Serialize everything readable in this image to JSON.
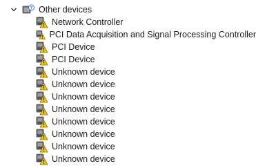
{
  "category": {
    "label": "Other devices",
    "expanded": true,
    "icon": "unknown-device-category-icon",
    "chevron_icon": "chevron-down-icon"
  },
  "devices": [
    {
      "label": "Network Controller",
      "icon": "warning-device-icon"
    },
    {
      "label": "PCI Data Acquisition and Signal Processing Controller",
      "icon": "warning-device-icon"
    },
    {
      "label": "PCI Device",
      "icon": "warning-device-icon"
    },
    {
      "label": "PCI Device",
      "icon": "warning-device-icon"
    },
    {
      "label": "Unknown device",
      "icon": "warning-device-icon"
    },
    {
      "label": "Unknown device",
      "icon": "warning-device-icon"
    },
    {
      "label": "Unknown device",
      "icon": "warning-device-icon"
    },
    {
      "label": "Unknown device",
      "icon": "warning-device-icon"
    },
    {
      "label": "Unknown device",
      "icon": "warning-device-icon"
    },
    {
      "label": "Unknown device",
      "icon": "warning-device-icon"
    },
    {
      "label": "Unknown device",
      "icon": "warning-device-icon"
    },
    {
      "label": "Unknown device",
      "icon": "warning-device-icon"
    }
  ],
  "colors": {
    "text": "#1a1a1a",
    "warning_fill": "#f5c518",
    "warning_stroke": "#8a6d00",
    "device_body": "#6b6b6b"
  }
}
